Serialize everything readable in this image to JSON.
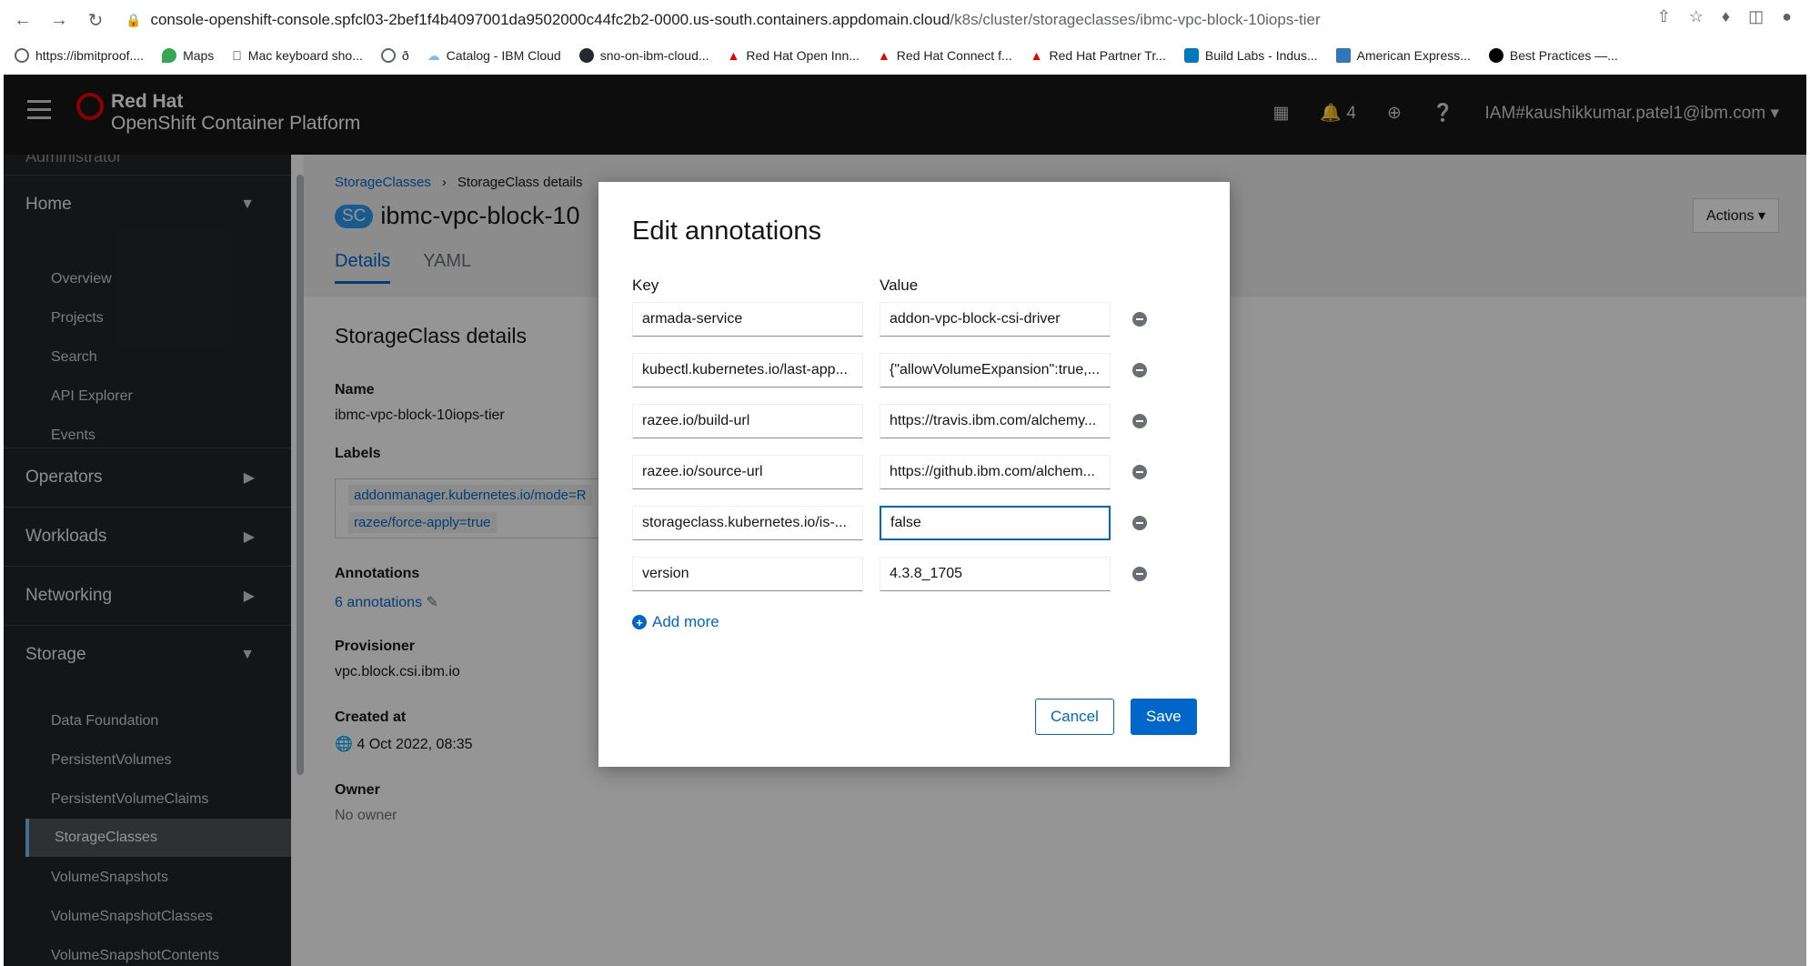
{
  "browser": {
    "url_host": "console-openshift-console.spfcl03-2bef1f4b4097001da9502000c44fc2b2-0000.us-south.containers.appdomain.cloud",
    "url_path": "/k8s/cluster/storageclasses/ibmc-vpc-block-10iops-tier",
    "bookmarks": [
      {
        "label": "https://ibmitproof....",
        "color": "#5f6368"
      },
      {
        "label": "Maps",
        "color": "#34a853"
      },
      {
        "label": "Mac keyboard sho...",
        "color": "#5f6368"
      },
      {
        "label": "ð",
        "color": "#5f6368"
      },
      {
        "label": "Catalog - IBM Cloud",
        "color": "#8ab4f8"
      },
      {
        "label": "sno-on-ibm-cloud...",
        "color": "#24292e"
      },
      {
        "label": "Red Hat Open Inn...",
        "color": "#ee0000"
      },
      {
        "label": "Red Hat Connect f...",
        "color": "#ee0000"
      },
      {
        "label": "Red Hat Partner Tr...",
        "color": "#ee0000"
      },
      {
        "label": "Build Labs - Indus...",
        "color": "#0079bf"
      },
      {
        "label": "American Express...",
        "color": "#2e77bc"
      },
      {
        "label": "Best Practices —...",
        "color": "#000000"
      }
    ]
  },
  "masthead": {
    "brand_top": "Red Hat",
    "brand_bottom": "OpenShift Container Platform",
    "notification_count": "4",
    "user": "IAM#kaushikkumar.patel1@ibm.com"
  },
  "sidebar": {
    "perspective": "Administrator",
    "groups": {
      "home": "Home",
      "operators": "Operators",
      "workloads": "Workloads",
      "networking": "Networking",
      "storage": "Storage"
    },
    "home_items": [
      "Overview",
      "Projects",
      "Search",
      "API Explorer",
      "Events"
    ],
    "storage_items": [
      "Data Foundation",
      "PersistentVolumes",
      "PersistentVolumeClaims",
      "StorageClasses",
      "VolumeSnapshots",
      "VolumeSnapshotClasses",
      "VolumeSnapshotContents"
    ]
  },
  "page": {
    "breadcrumb_link": "StorageClasses",
    "breadcrumb_current": "StorageClass details",
    "badge": "SC",
    "title": "ibmc-vpc-block-10",
    "actions": "Actions",
    "tab_details": "Details",
    "tab_yaml": "YAML",
    "section_heading": "StorageClass details",
    "name_label": "Name",
    "name_value": "ibmc-vpc-block-10iops-tier",
    "labels_label": "Labels",
    "label_1": "addonmanager.kubernetes.io/mode=R",
    "label_2": "razee/force-apply=true",
    "annotations_label": "Annotations",
    "annotations_link": "6 annotations",
    "provisioner_label": "Provisioner",
    "provisioner_value": "vpc.block.csi.ibm.io",
    "created_label": "Created at",
    "created_value": "4 Oct 2022, 08:35",
    "owner_label": "Owner",
    "owner_value": "No owner"
  },
  "modal": {
    "title": "Edit annotations",
    "key_header": "Key",
    "value_header": "Value",
    "rows": [
      {
        "key": "armada-service",
        "value": "addon-vpc-block-csi-driver"
      },
      {
        "key": "kubectl.kubernetes.io/last-app...",
        "value": "{\"allowVolumeExpansion\":true,..."
      },
      {
        "key": "razee.io/build-url",
        "value": "https://travis.ibm.com/alchemy..."
      },
      {
        "key": "razee.io/source-url",
        "value": "https://github.ibm.com/alchem..."
      },
      {
        "key": "storageclass.kubernetes.io/is-...",
        "value": "false"
      },
      {
        "key": "version",
        "value": "4.3.8_1705"
      }
    ],
    "add_more": "Add more",
    "cancel": "Cancel",
    "save": "Save"
  }
}
